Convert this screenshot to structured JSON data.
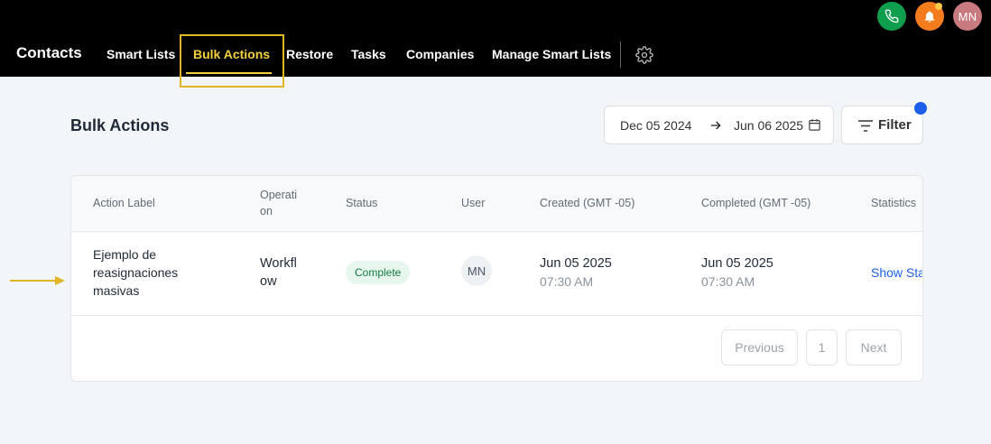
{
  "topbar": {
    "avatar_initials": "MN",
    "brand": "Contacts",
    "nav": {
      "smart_lists": "Smart Lists",
      "bulk_actions": "Bulk Actions",
      "restore": "Restore",
      "tasks": "Tasks",
      "companies": "Companies",
      "manage_smart_lists": "Manage Smart Lists"
    },
    "colors": {
      "active": "#f4d03f",
      "phone": "#0f9d4e",
      "bell": "#f47c1c",
      "avatar": "#c97a7f"
    }
  },
  "page": {
    "title": "Bulk Actions",
    "date_range": {
      "start": "Dec 05 2024",
      "end": "Jun 06 2025"
    },
    "filter_label": "Filter"
  },
  "table": {
    "headers": {
      "action_label": "Action Label",
      "operation_line1": "Operati",
      "operation_line2": "on",
      "status": "Status",
      "user": "User",
      "created": "Created (GMT -05)",
      "completed": "Completed (GMT -05)",
      "statistics": "Statistics"
    },
    "rows": [
      {
        "action_label_line1": "Ejemplo de",
        "action_label_line2": "reasignaciones",
        "action_label_line3": "masivas",
        "operation_line1": "Workfl",
        "operation_line2": "ow",
        "status": "Complete",
        "user_initials": "MN",
        "created_date": "Jun 05 2025",
        "created_time": "07:30 AM",
        "completed_date": "Jun 05 2025",
        "completed_time": "07:30 AM",
        "statistics_link": "Show Sta"
      }
    ]
  },
  "pagination": {
    "previous": "Previous",
    "page": "1",
    "next": "Next"
  }
}
